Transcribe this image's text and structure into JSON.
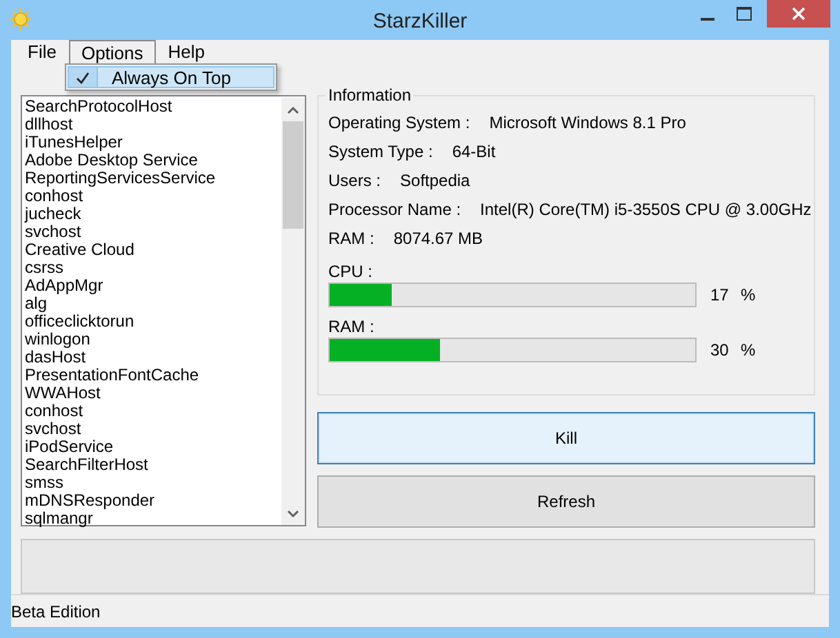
{
  "window": {
    "title": "StarzKiller"
  },
  "menu": [
    {
      "label": "File",
      "selected": false
    },
    {
      "label": "Options",
      "selected": true
    },
    {
      "label": "Help",
      "selected": false
    }
  ],
  "dropdown": [
    {
      "label": "Always On Top",
      "checked": true
    }
  ],
  "processes": [
    "SearchProtocolHost",
    "dllhost",
    "iTunesHelper",
    "Adobe Desktop Service",
    "ReportingServicesService",
    "conhost",
    "jucheck",
    "svchost",
    "Creative Cloud",
    "csrss",
    "AdAppMgr",
    "alg",
    "officeclicktorun",
    "winlogon",
    "dasHost",
    "PresentationFontCache",
    "WWAHost",
    "conhost",
    "svchost",
    "iPodService",
    "SearchFilterHost",
    "smss",
    "mDNSResponder",
    "sqlmangr"
  ],
  "information": {
    "title": "Information",
    "rows": [
      {
        "label": "Operating System :",
        "value": "Microsoft Windows 8.1 Pro"
      },
      {
        "label": "System Type :",
        "value": "64-Bit"
      },
      {
        "label": "Users :",
        "value": "Softpedia"
      },
      {
        "label": "Processor Name :",
        "value": "Intel(R) Core(TM) i5-3550S CPU @ 3.00GHz"
      },
      {
        "label": "RAM :",
        "value": "8074.67 MB"
      }
    ],
    "meters": [
      {
        "label": "CPU :",
        "level": 0.17,
        "reading": "17",
        "unit": "%"
      },
      {
        "label": "RAM :",
        "level": 0.3,
        "reading": "30",
        "unit": "%"
      }
    ]
  },
  "buttons": [
    {
      "label": "Kill",
      "focused": true
    },
    {
      "label": "Refresh",
      "focused": false
    }
  ],
  "status_bar": "Beta Edition"
}
